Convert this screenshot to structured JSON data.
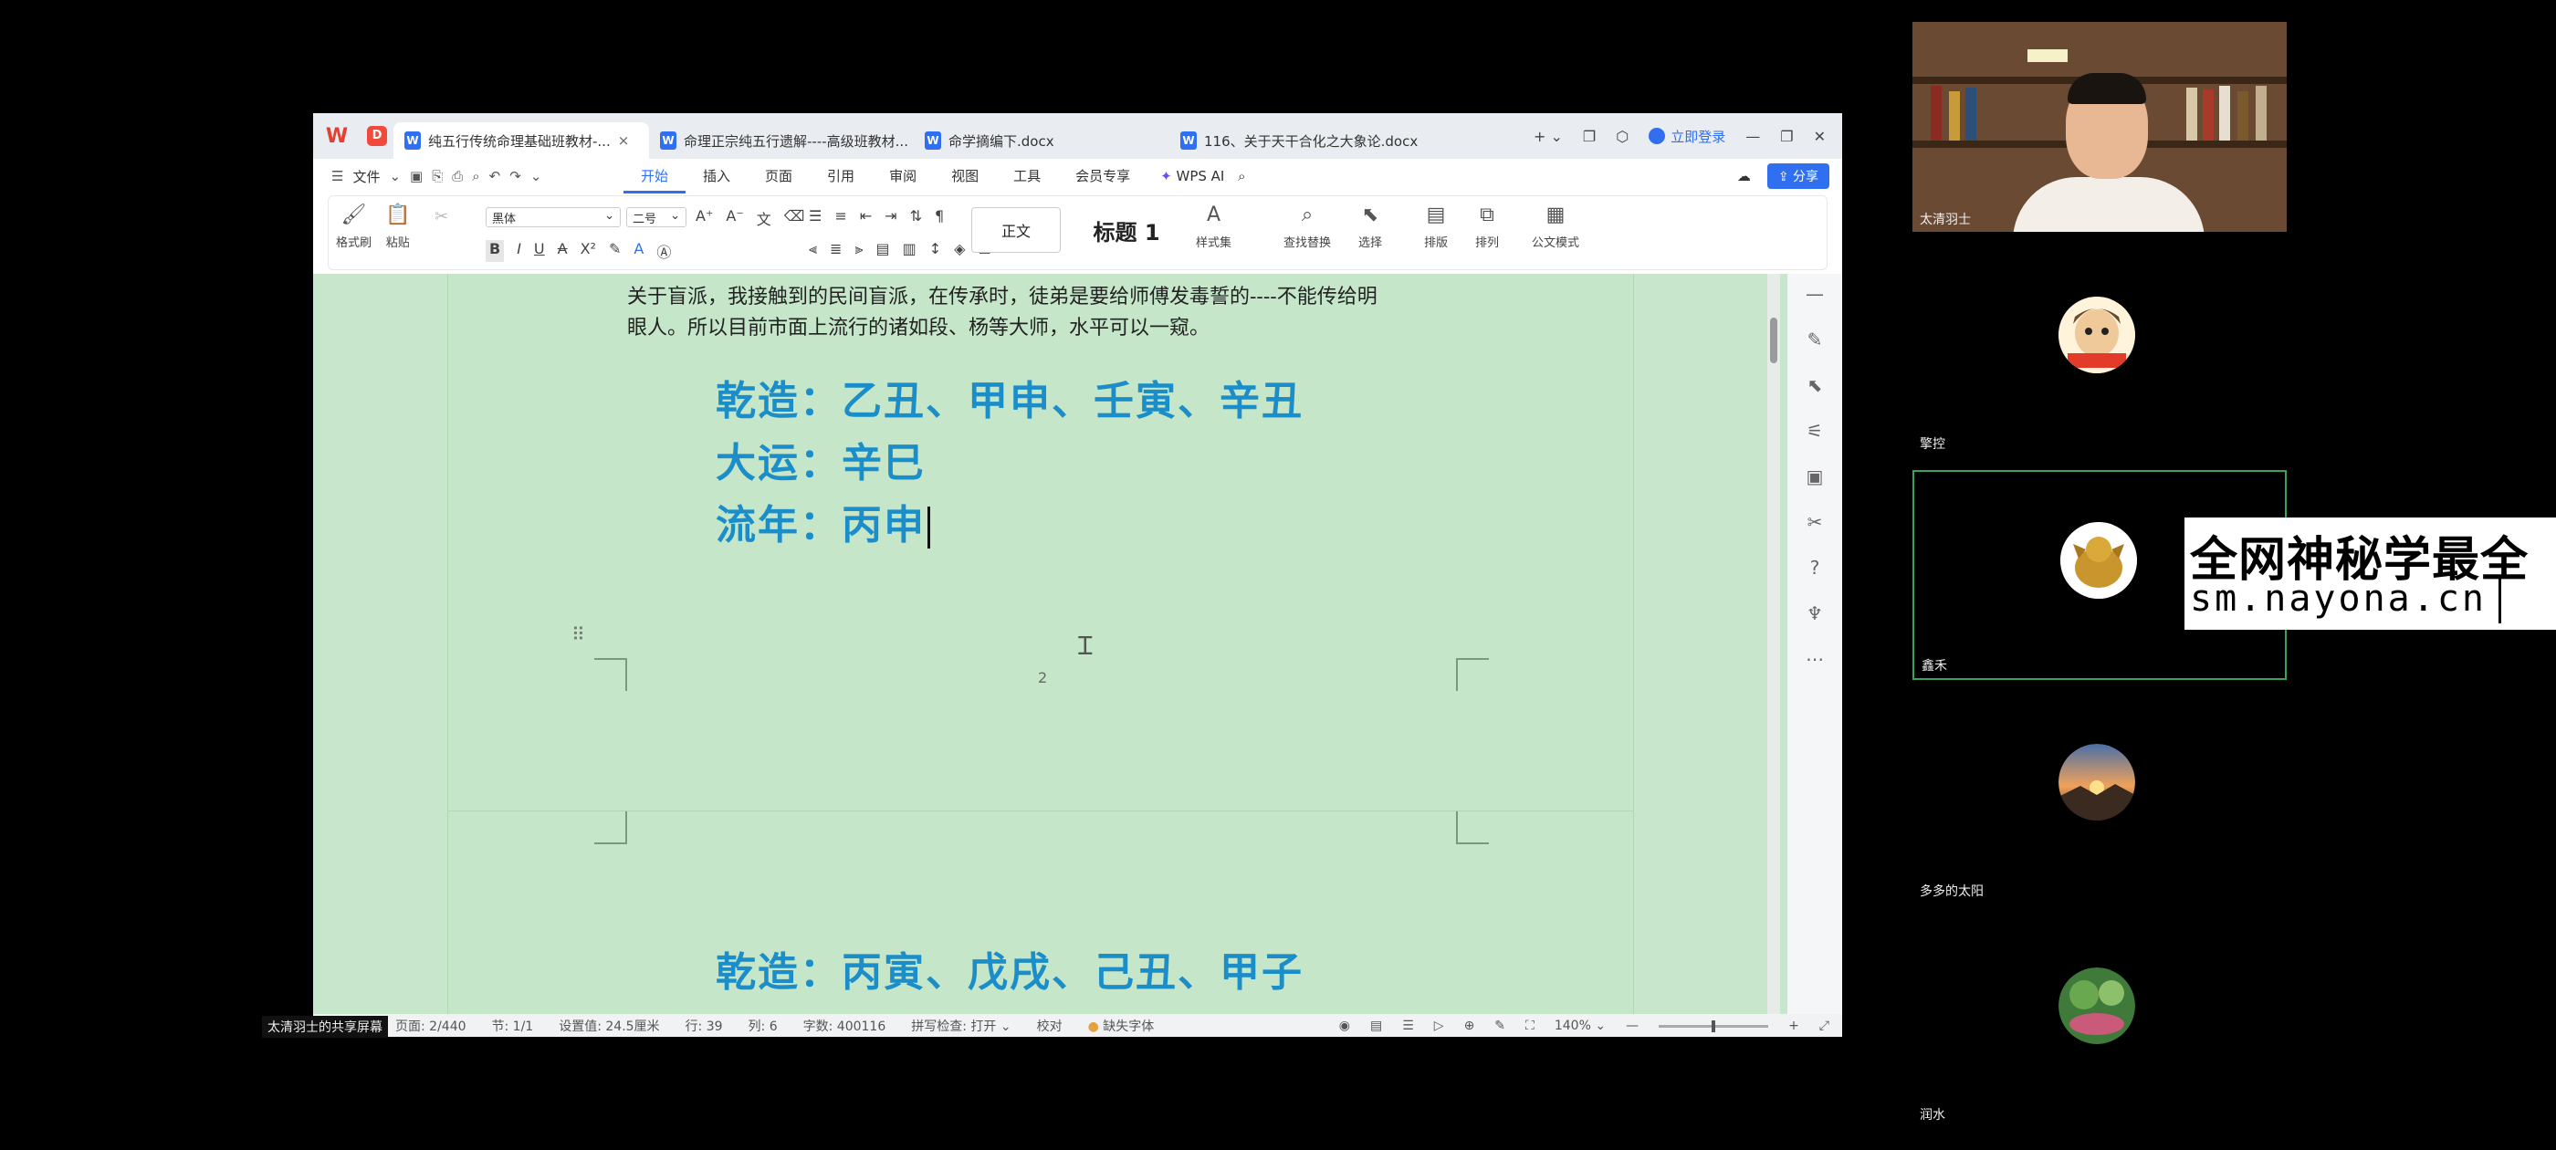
{
  "wps": {
    "tabs": [
      {
        "label": "纯五行传统命理基础班教材-...",
        "active": true
      },
      {
        "label": "命理正宗纯五行遗解----高级班教材..."
      },
      {
        "label": "命学摘编下.docx"
      },
      {
        "label": "116、关于天干合化之大象论.docx"
      }
    ],
    "login_label": "立即登录",
    "file_menu": "文件",
    "menu_tabs": [
      "开始",
      "插入",
      "页面",
      "引用",
      "审阅",
      "视图",
      "工具",
      "会员专享"
    ],
    "wps_ai": "WPS AI",
    "share_btn": "分享",
    "ribbon": {
      "format_painter": "格式刷",
      "paste": "粘贴",
      "font_name": "黑体",
      "font_size": "二号",
      "style_normal": "正文",
      "style_heading": "标题 1",
      "styles": "样式集",
      "find_replace": "查找替换",
      "select": "选择",
      "layout": "排版",
      "arrange": "排列",
      "official_mode": "公文模式"
    }
  },
  "document": {
    "para_line1": "关于盲派，我接触到的民间盲派，在传承时，徒弟是要给师傅发毒誓的----不能传给明",
    "para_line2": "眼人。所以目前市面上流行的诸如段、杨等大师，水平可以一窥。",
    "chart1": [
      "乾造：乙丑、甲申、壬寅、辛丑",
      "大运：辛巳",
      "流年：丙申"
    ],
    "page_number": "2",
    "chart2": "乾造：丙寅、戊戌、己丑、甲子"
  },
  "status": {
    "page": "页面: 2/440",
    "section": "节: 1/1",
    "setting": "设置值: 24.5厘米",
    "row": "行: 39",
    "col": "列: 6",
    "words": "字数: 400116",
    "spell": "拼写检查: 打开",
    "proof": "校对",
    "missing_font": "缺失字体",
    "zoom": "140%"
  },
  "share_label": "太清羽士的共享屏幕",
  "participants": {
    "host": "太清羽士",
    "p1": "擎控",
    "p2": "鑫禾",
    "p3": "多多的太阳",
    "p4": "润水"
  },
  "watermark": {
    "line1": "全网神秘学最全",
    "line2": "sm.nayona.cn"
  },
  "colors": {
    "doc_bg": "#c8e6cc",
    "chart_text": "#1b8ec9",
    "accent": "#2f6ff0"
  }
}
